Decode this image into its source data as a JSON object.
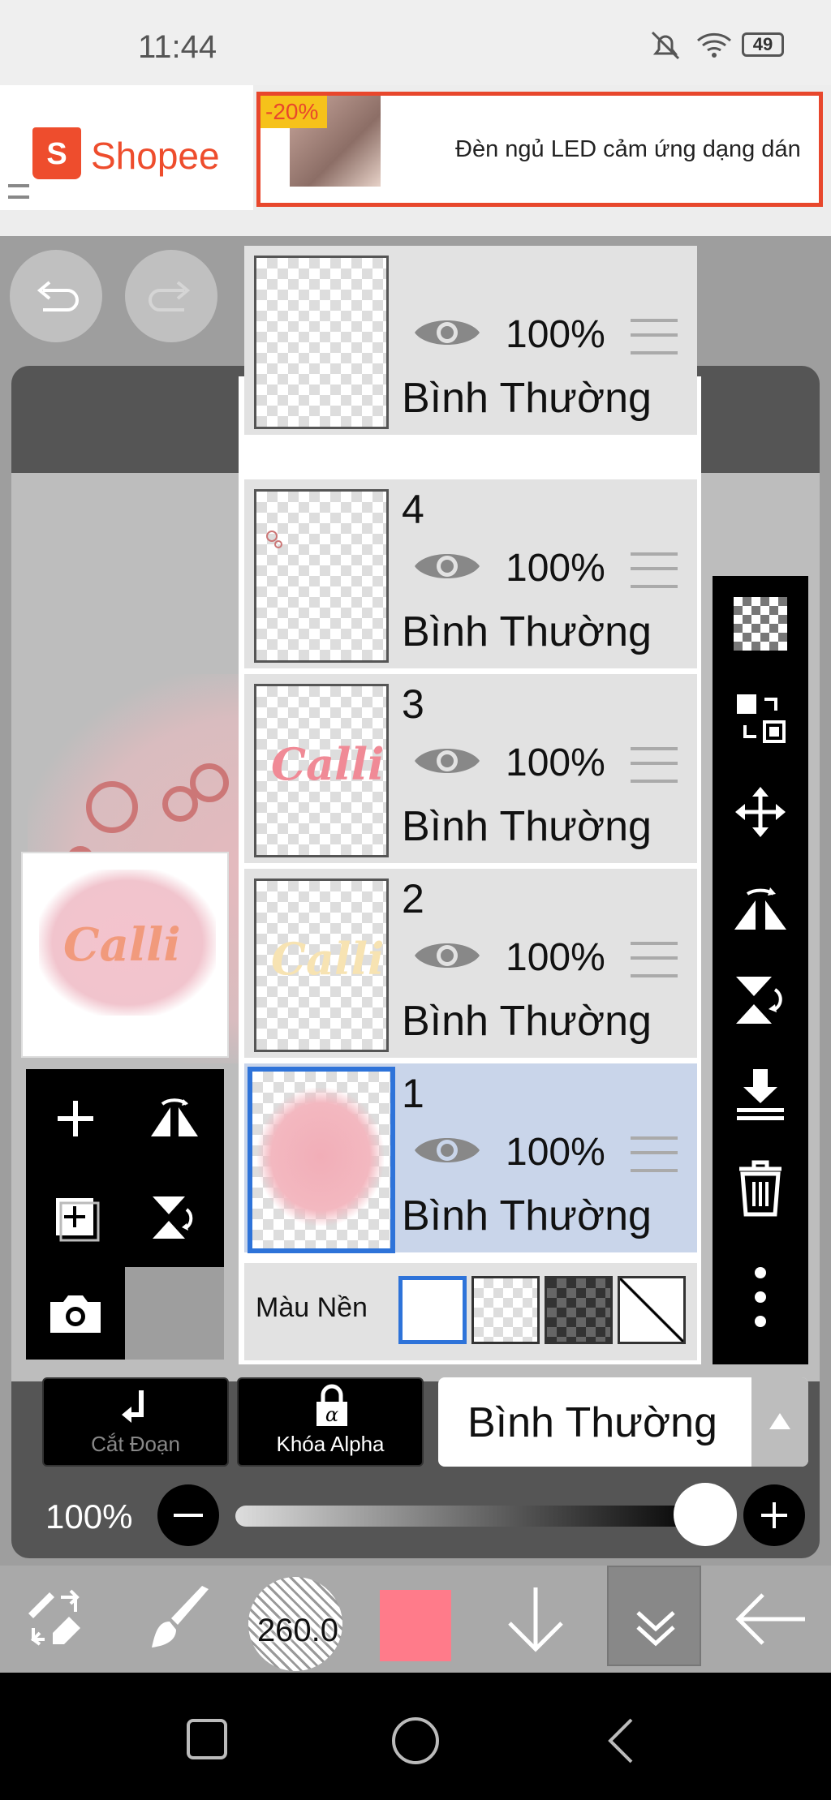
{
  "status_bar": {
    "time": "11:44",
    "battery": "49"
  },
  "ad": {
    "brand": "Shopee",
    "brand_icon_letter": "S",
    "discount": "-20%",
    "product_title": "Đèn ngủ LED cảm ứng dạng dán"
  },
  "layers": [
    {
      "number": "",
      "opacity": "100%",
      "mode": "Bình Thường",
      "selected": false
    },
    {
      "number": "4",
      "opacity": "100%",
      "mode": "Bình Thường",
      "selected": false
    },
    {
      "number": "3",
      "opacity": "100%",
      "mode": "Bình Thường",
      "selected": false
    },
    {
      "number": "2",
      "opacity": "100%",
      "mode": "Bình Thường",
      "selected": false
    },
    {
      "number": "1",
      "opacity": "100%",
      "mode": "Bình Thường",
      "selected": true
    }
  ],
  "background_row": {
    "label": "Màu Nền"
  },
  "thumb_art_text": "Calli",
  "controls": {
    "cut_label": "Cắt Đoạn",
    "alpha_lock_label": "Khóa Alpha",
    "blend_mode": "Bình Thường",
    "opacity": "100%"
  },
  "toolbar": {
    "brush_size": "260.0",
    "color": "#ff7b8a"
  },
  "icons": [
    "undo-icon",
    "redo-icon",
    "add-layer-icon",
    "flip-icon",
    "add-photo-layer-icon",
    "rotate-flip-icon",
    "camera-icon",
    "checker-icon",
    "transform-icon",
    "move-icon",
    "flip-horizontal-icon",
    "flip-vertical-icon",
    "merge-down-icon",
    "trash-icon",
    "more-icon",
    "eye-icon",
    "brush-eraser-icon",
    "brush-icon",
    "arrow-down-icon",
    "chevron-double-down-icon",
    "arrow-left-icon"
  ]
}
